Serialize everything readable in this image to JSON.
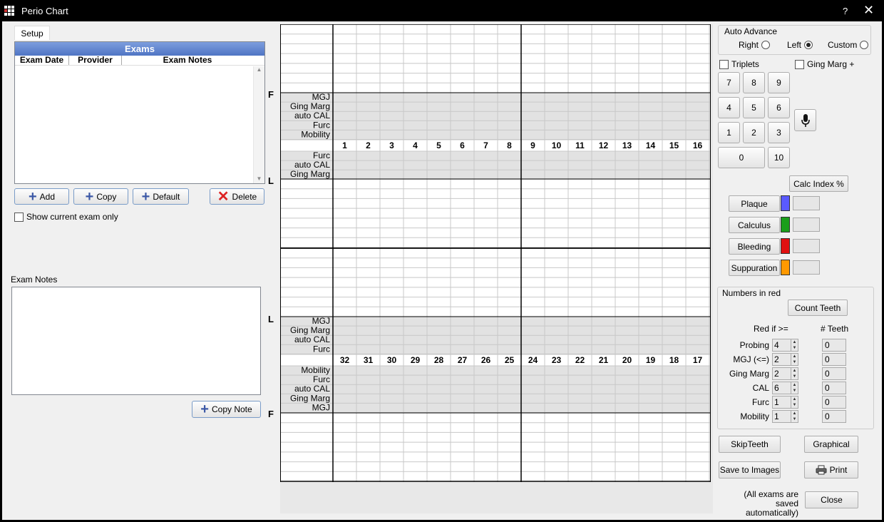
{
  "window": {
    "title": "Perio Chart",
    "help": "?",
    "close": "✕"
  },
  "left": {
    "tab_setup": "Setup",
    "exams_title": "Exams",
    "columns": [
      "Exam Date",
      "Provider",
      "Exam Notes"
    ],
    "add": "Add",
    "copy": "Copy",
    "default": "Default",
    "delete": "Delete",
    "show_current": "Show current exam only",
    "notes_label": "Exam Notes",
    "copy_note": "Copy Note"
  },
  "chart": {
    "upper_rows": [
      "MGJ",
      "Ging Marg",
      "auto CAL",
      "Furc",
      "Mobility"
    ],
    "upper_lingual_rows": [
      "Furc",
      "auto CAL",
      "Ging Marg"
    ],
    "lower_lingual_rows": [
      "MGJ",
      "Ging Marg",
      "auto CAL",
      "Furc"
    ],
    "lower_rows": [
      "Mobility",
      "Furc",
      "auto CAL",
      "Ging Marg",
      "MGJ"
    ],
    "upper_teeth": [
      "1",
      "2",
      "3",
      "4",
      "5",
      "6",
      "7",
      "8",
      "9",
      "10",
      "11",
      "12",
      "13",
      "14",
      "15",
      "16"
    ],
    "lower_teeth": [
      "32",
      "31",
      "30",
      "29",
      "28",
      "27",
      "26",
      "25",
      "24",
      "23",
      "22",
      "21",
      "20",
      "19",
      "18",
      "17"
    ],
    "side_labels": [
      "F",
      "L",
      "L",
      "F"
    ]
  },
  "right": {
    "auto_advance": "Auto Advance",
    "right": "Right",
    "left": "Left",
    "custom": "Custom",
    "triplets": "Triplets",
    "ging_marg_plus": "Ging Marg +",
    "keys": [
      "7",
      "8",
      "9",
      "4",
      "5",
      "6",
      "1",
      "2",
      "3",
      "0",
      "10"
    ],
    "calc_index": "Calc Index %",
    "plaque": "Plaque",
    "calculus": "Calculus",
    "bleeding": "Bleeding",
    "suppuration": "Suppuration",
    "colors": {
      "plaque": "#5a5aff",
      "calculus": "#1a9e1a",
      "bleeding": "#e01010",
      "suppuration": "#ff9900"
    },
    "numbers_in_red": "Numbers in red",
    "count_teeth": "Count Teeth",
    "red_if": "Red if >=",
    "num_teeth": "# Teeth",
    "thresholds": [
      {
        "label": "Probing",
        "value": "4",
        "count": "0"
      },
      {
        "label": "MGJ (<=)",
        "value": "2",
        "count": "0"
      },
      {
        "label": "Ging Marg",
        "value": "2",
        "count": "0"
      },
      {
        "label": "CAL",
        "value": "6",
        "count": "0"
      },
      {
        "label": "Furc",
        "value": "1",
        "count": "0"
      },
      {
        "label": "Mobility",
        "value": "1",
        "count": "0"
      }
    ],
    "skip_teeth": "SkipTeeth",
    "graphical": "Graphical",
    "save_images": "Save to Images",
    "print": "Print",
    "autosave_note1": "(All exams are saved",
    "autosave_note2": "automatically)",
    "close": "Close"
  }
}
